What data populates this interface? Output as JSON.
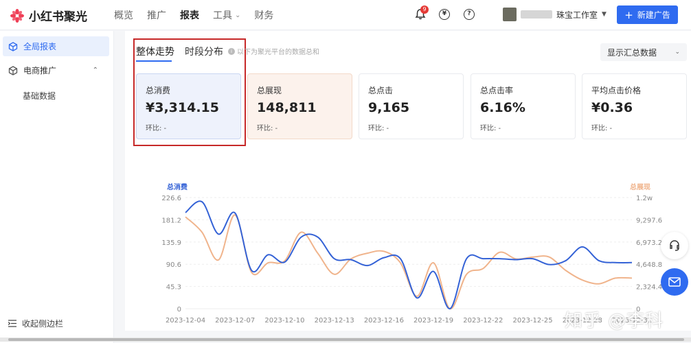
{
  "app": {
    "logo_text": "小红书聚光"
  },
  "nav": [
    {
      "label": "概览",
      "active": false
    },
    {
      "label": "推广",
      "active": false
    },
    {
      "label": "报表",
      "active": true
    },
    {
      "label": "工具",
      "active": false,
      "has_dropdown": true
    },
    {
      "label": "财务",
      "active": false
    }
  ],
  "header": {
    "notification_count": "9",
    "yuan_icon": "¥",
    "help_icon": "?",
    "account_name": "珠宝工作室",
    "new_button": "新建广告",
    "new_button_plus": "+"
  },
  "sidebar": {
    "items": [
      {
        "label": "全局报表",
        "icon": "cube-icon",
        "active": true
      },
      {
        "label": "电商推广",
        "icon": "cube-icon",
        "active": false,
        "expanded": true
      }
    ],
    "sub_items": [
      {
        "label": "基础数据"
      }
    ],
    "collapse_label": "收起侧边栏"
  },
  "main": {
    "tabs": [
      {
        "label": "整体走势",
        "active": true
      },
      {
        "label": "时段分布",
        "active": false
      }
    ],
    "hint": "以下为聚光平台的数据总和",
    "hint_icon": "i",
    "select_value": "显示汇总数据",
    "metrics": [
      {
        "label": "总消费",
        "value": "¥3,314.15",
        "ring": "环比:  -",
        "highlight": "blue"
      },
      {
        "label": "总展现",
        "value": "148,811",
        "ring": "环比:  -",
        "highlight": "orange"
      },
      {
        "label": "总点击",
        "value": "9,165",
        "ring": "环比:  -",
        "highlight": "none"
      },
      {
        "label": "总点击率",
        "value": "6.16%",
        "ring": "环比:  -",
        "highlight": "none"
      },
      {
        "label": "平均点击价格",
        "value": "¥0.36",
        "ring": "环比:  -",
        "highlight": "none"
      }
    ]
  },
  "watermark": "知乎 @李科",
  "colors": {
    "accent": "#2f6bf0",
    "series_spend": "#3462d6",
    "series_impr": "#f0b48c",
    "highlight_box": "#c62828"
  },
  "chart_data": {
    "type": "line",
    "x": [
      "2023-12-04",
      "2023-12-05",
      "2023-12-06",
      "2023-12-07",
      "2023-12-08",
      "2023-12-09",
      "2023-12-10",
      "2023-12-11",
      "2023-12-12",
      "2023-12-13",
      "2023-12-14",
      "2023-12-15",
      "2023-12-16",
      "2023-12-17",
      "2023-12-18",
      "2023-12-19",
      "2023-12-20",
      "2023-12-21",
      "2023-12-22",
      "2023-12-23",
      "2023-12-24",
      "2023-12-25",
      "2023-12-26",
      "2023-12-27",
      "2023-12-28",
      "2023-12-29",
      "2023-12-30",
      "2023-12-31"
    ],
    "x_tick_labels": [
      "2023-12-04",
      "2023-12-07",
      "2023-12-10",
      "2023-12-13",
      "2023-12-16",
      "2023-12-19",
      "2023-12-22",
      "2023-12-25",
      "2023-12-28",
      "2023-12-31"
    ],
    "series": [
      {
        "name": "总消费",
        "axis": "left",
        "color": "#3462d6",
        "values": [
          196,
          218,
          152,
          195,
          78,
          110,
          95,
          146,
          146,
          102,
          100,
          88,
          104,
          102,
          22,
          76,
          0,
          102,
          102,
          102,
          100,
          102,
          90,
          98,
          126,
          98,
          94,
          94
        ]
      },
      {
        "name": "总展现",
        "axis": "left_scaled",
        "color": "#f0b48c",
        "values": [
          9600,
          8000,
          5100,
          9800,
          3800,
          4800,
          5000,
          8000,
          5800,
          3600,
          5200,
          5800,
          6000,
          4800,
          1300,
          4800,
          0,
          3600,
          4200,
          5900,
          5200,
          5400,
          5400,
          4000,
          3000,
          2600,
          3200,
          3200
        ]
      }
    ],
    "y_left": {
      "label": "总消费",
      "ticks": [
        "226.6",
        "181.2",
        "135.9",
        "90.6",
        "45.3",
        "0"
      ],
      "min": 0,
      "max": 226.6
    },
    "y_right": {
      "label": "总展现",
      "ticks": [
        "1.2w",
        "9,297.6",
        "6,973.2",
        "4,648.8",
        "2,324.4",
        "0"
      ],
      "min": 0,
      "max": 11622
    },
    "grid": true
  }
}
